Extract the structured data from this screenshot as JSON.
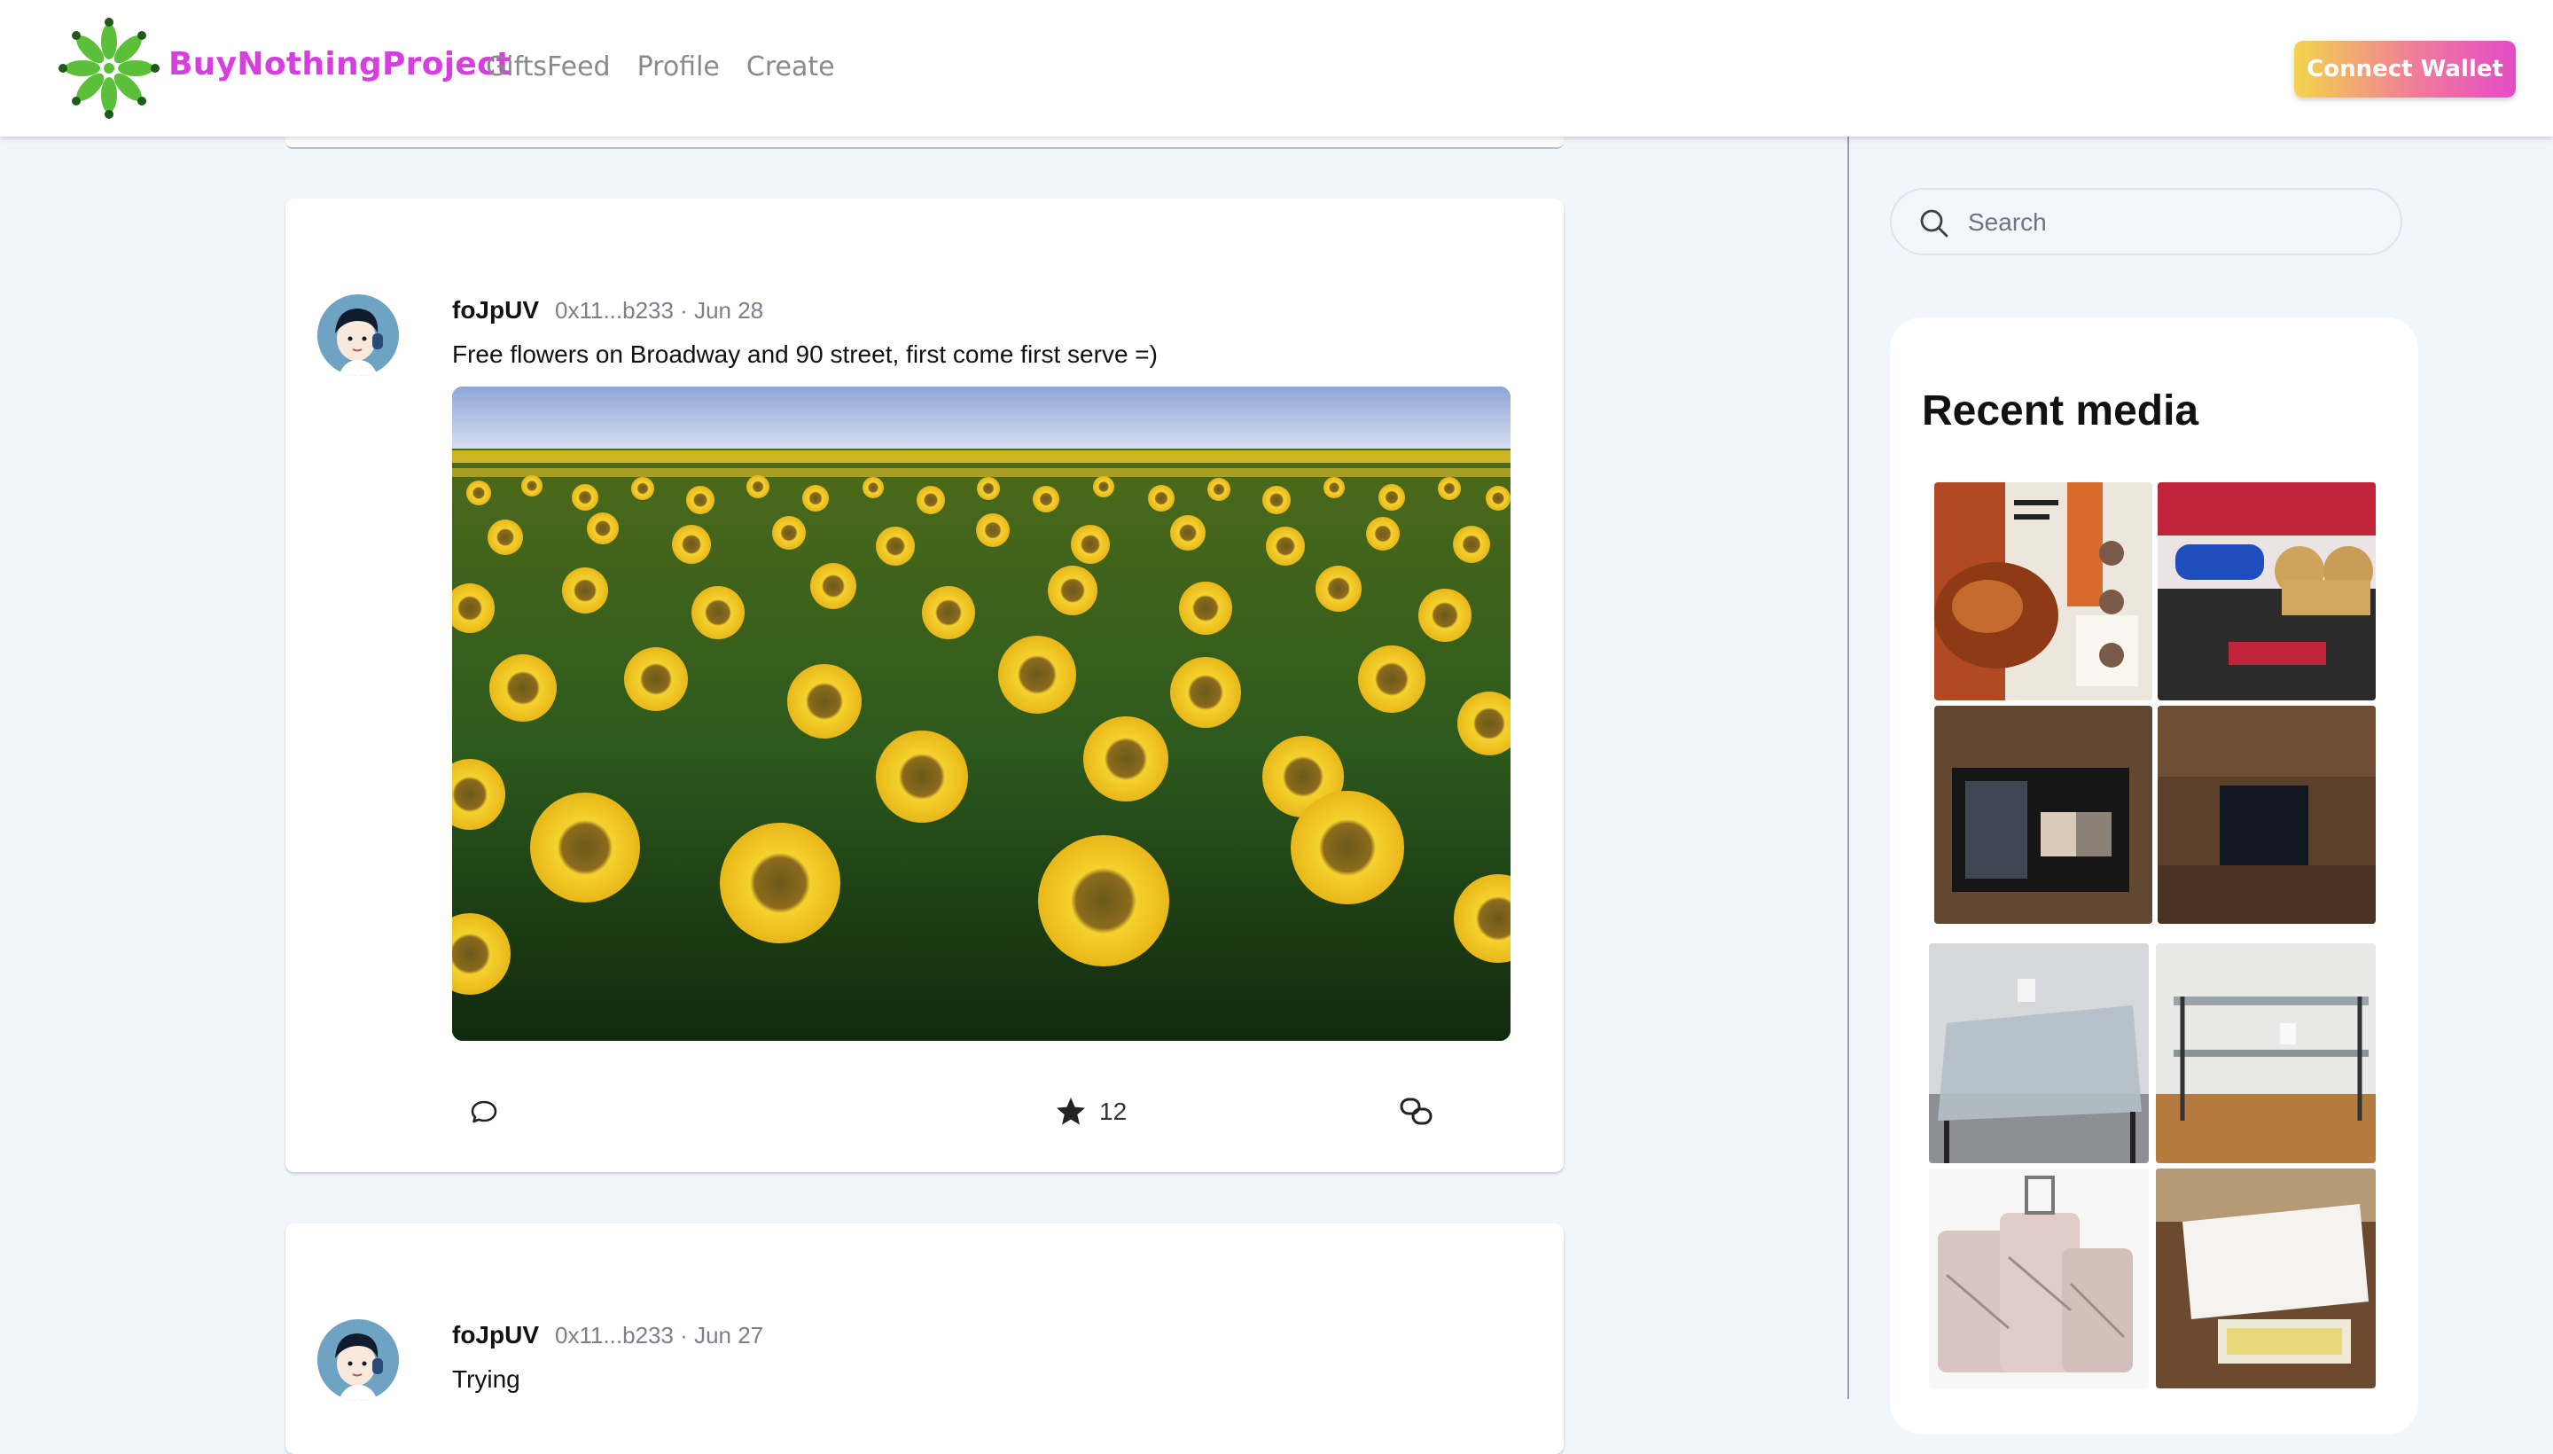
{
  "header": {
    "brand": "BuyNothingProject",
    "nav": [
      "GiftsFeed",
      "Profile",
      "Create"
    ],
    "connect_label": "Connect Wallet"
  },
  "feed": {
    "posts": [
      {
        "author": "foJpUV",
        "handle_date": "0x11...b233 · Jun 28",
        "text": "Free flowers on Broadway and 90 street, first come first serve =)",
        "image": "sunflower-field-photo",
        "likes": "12"
      },
      {
        "author": "foJpUV",
        "handle_date": "0x11...b233 · Jun 27",
        "text": "Trying"
      }
    ]
  },
  "sidebar": {
    "search_placeholder": "Search",
    "media_title": "Recent media",
    "thumbnails": [
      "magazine-turkey-photo",
      "phillies-cups-photo",
      "eyeshadow-palette-photo",
      "mac-box-photo",
      "glass-table-photo",
      "glass-desk-photo",
      "luggage-set-photo",
      "white-desk-photo"
    ]
  },
  "colors": {
    "brand": "#d63ee0",
    "background": "#f0f6fc",
    "wallet_gradient": [
      "#f3d44c",
      "#e44bc8"
    ]
  }
}
